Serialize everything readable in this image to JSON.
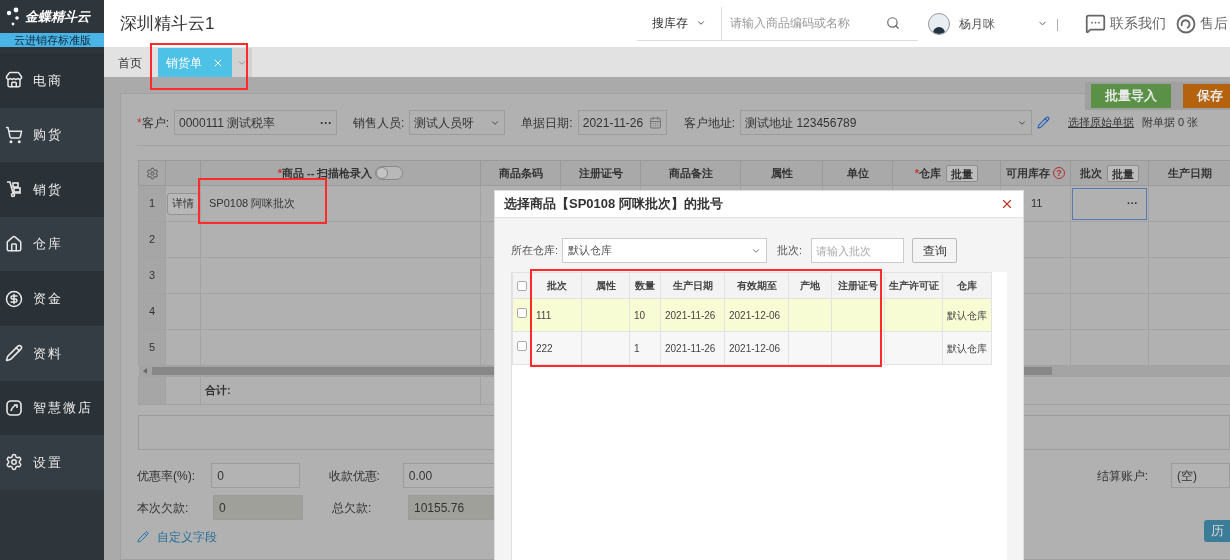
{
  "app": {
    "logo": "金蝶精斗云",
    "edition": "云进销存标准版"
  },
  "sidebar": {
    "items": [
      {
        "label": "电商"
      },
      {
        "label": "购货"
      },
      {
        "label": "销货"
      },
      {
        "label": "仓库"
      },
      {
        "label": "资金"
      },
      {
        "label": "资料"
      },
      {
        "label": "智慧微店"
      },
      {
        "label": "设置"
      }
    ]
  },
  "header": {
    "company": "深圳精斗云1",
    "search_scope": "搜库存",
    "search_placeholder": "请输入商品编码或名称",
    "user": "杨月咪",
    "separator": "|",
    "contact": "联系我们",
    "after_sales": "售后"
  },
  "tabs": [
    {
      "label": "首页",
      "selected": false,
      "closable": false
    },
    {
      "label": "销货单",
      "selected": true,
      "closable": true
    }
  ],
  "toolbar_buttons": [
    {
      "label": "批量导入",
      "kind": "import"
    },
    {
      "label": "保存",
      "kind": "save"
    }
  ],
  "required_mark": "*",
  "form": {
    "customer": {
      "label": "客户:",
      "value": "0000111 测试税率",
      "lookup": "···",
      "required": true
    },
    "salesperson": {
      "label": "销售人员:",
      "value": "测试人员呀"
    },
    "date": {
      "label": "单据日期:",
      "value": "2021-11-26"
    },
    "address": {
      "label": "客户地址:",
      "value": "测试地址 123456789"
    },
    "source_link": "选择原始单据",
    "attachments": "附单据 0 张"
  },
  "grid": {
    "columns": [
      {
        "label": "商品 -- 扫描枪录入",
        "required": true,
        "toggle_on": false
      },
      {
        "label": "商品条码"
      },
      {
        "label": "注册证号"
      },
      {
        "label": "商品备注"
      },
      {
        "label": "属性"
      },
      {
        "label": "单位"
      },
      {
        "label": "仓库",
        "required": true,
        "button": "批量"
      },
      {
        "label": "可用库存",
        "help": "?"
      },
      {
        "label": "批次",
        "button": "批量"
      },
      {
        "label": "生产日期"
      }
    ],
    "rows": [
      {
        "number": "1",
        "detail": "详情",
        "product": "SP0108 阿咪批次",
        "stock": "11",
        "batch": "···",
        "batch_active": true
      },
      {
        "number": "2"
      },
      {
        "number": "3"
      },
      {
        "number": "4"
      },
      {
        "number": "5"
      }
    ],
    "total_label": "合计:"
  },
  "footer": {
    "fields": [
      {
        "label": "优惠率(%):",
        "value": "0",
        "disabled": false
      },
      {
        "label": "收款优惠:",
        "value": "0.00",
        "disabled": false
      },
      {
        "label": "结算账户:",
        "value": "(空)",
        "disabled": false
      },
      {
        "label": "本次欠款:",
        "value": "0",
        "disabled": true
      },
      {
        "label": "总欠款:",
        "value": "10155.76",
        "disabled": true
      }
    ],
    "custom_fields_link": "自定义字段",
    "history_button": "历"
  },
  "modal": {
    "title": "选择商品【SP0108 阿咪批次】的批号",
    "warehouse": {
      "label": "所在仓库:",
      "value": "默认仓库"
    },
    "batch": {
      "label": "批次:",
      "placeholder": "请输入批次"
    },
    "query_button": "查询",
    "all_checked": false,
    "columns": [
      {
        "label": "批次"
      },
      {
        "label": "属性"
      },
      {
        "label": "数量"
      },
      {
        "label": "生产日期"
      },
      {
        "label": "有效期至"
      },
      {
        "label": "产地"
      },
      {
        "label": "注册证号"
      },
      {
        "label": "生产许可证"
      },
      {
        "label": "仓库"
      }
    ],
    "rows": [
      {
        "checked": false,
        "highlighted": true,
        "batch": "111",
        "qty": "10",
        "prod": "2021-11-26",
        "exp": "2021-12-06",
        "wh": "默认仓库"
      },
      {
        "checked": false,
        "highlighted": false,
        "batch": "222",
        "qty": "1",
        "prod": "2021-11-26",
        "exp": "2021-12-06",
        "wh": "默认仓库"
      }
    ]
  }
}
